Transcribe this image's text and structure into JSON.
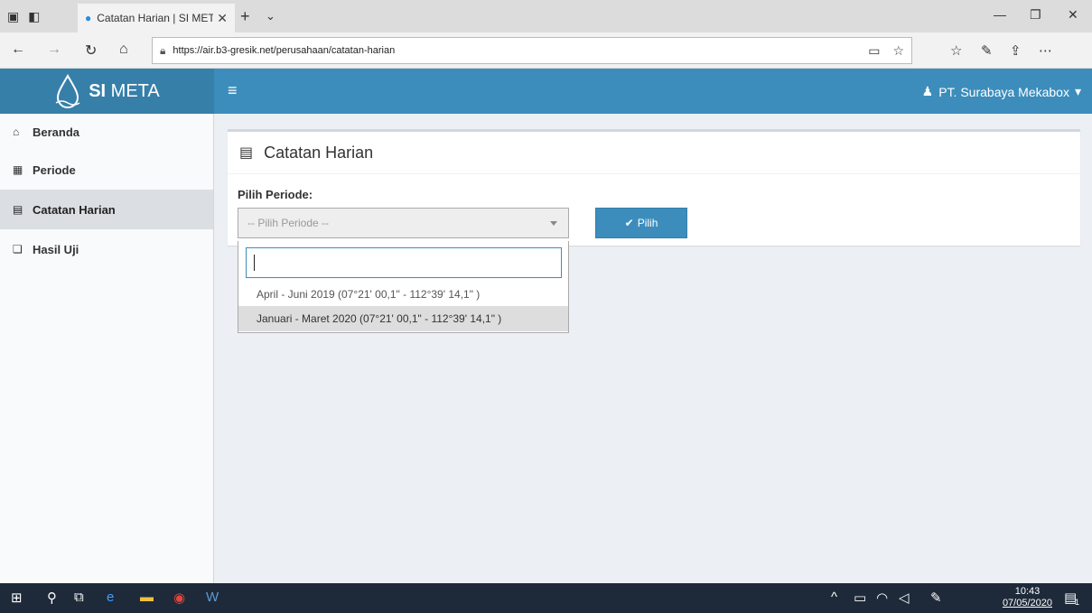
{
  "browser": {
    "tab_title": "Catatan Harian | SI MET.",
    "url": "https://air.b3-gresik.net/perusahaan/catatan-harian"
  },
  "app": {
    "logo_bold": "SI",
    "logo_rest": " META",
    "user": "PT. Surabaya Mekabox"
  },
  "sidebar": {
    "items": [
      {
        "label": "Beranda",
        "icon": "home-icon"
      },
      {
        "label": "Periode",
        "icon": "calendar-icon"
      },
      {
        "label": "Catatan Harian",
        "icon": "file-icon"
      },
      {
        "label": "Hasil Uji",
        "icon": "copy-icon"
      }
    ],
    "active_index": 2
  },
  "main": {
    "title": "Catatan Harian",
    "periode_label": "Pilih Periode:",
    "select_placeholder": "-- Pilih Periode --",
    "button_label": "Pilih",
    "options": [
      "April - Juni 2019 (07°21' 00,1\" - 112°39' 14,1\" )",
      "Januari - Maret 2020 (07°21' 00,1\" - 112°39' 14,1\" )"
    ],
    "highlighted_option": 1
  },
  "taskbar": {
    "time": "10:43",
    "date": "07/05/2020",
    "notification_count": "1"
  },
  "colors": {
    "header": "#3c8dbc",
    "logo_bg": "#367fa9",
    "taskbar": "#1e2a3a"
  }
}
